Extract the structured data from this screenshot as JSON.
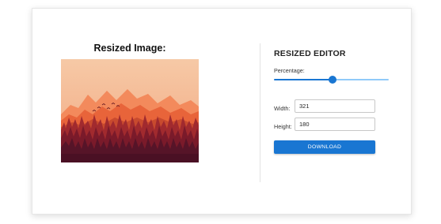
{
  "preview": {
    "title": "Resized Image:",
    "image_description": "stylized landscape illustration of orange mountains at sunset with a dark red pine forest and flying birds"
  },
  "editor": {
    "title": "RESIZED EDITOR",
    "percentage_label": "Percentage:",
    "percentage_fraction": 0.51,
    "width_label": "Width:",
    "width_value": "321",
    "height_label": "Height:",
    "height_value": "180",
    "download_label": "DOWNLOAD"
  },
  "colors": {
    "accent": "#1976d2",
    "accent_light": "#90caf9"
  }
}
